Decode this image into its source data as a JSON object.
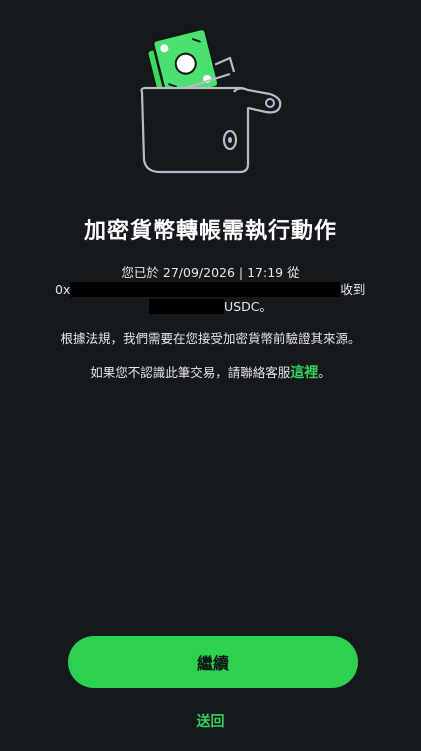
{
  "title": "加密貨幣轉帳需執行動作",
  "details": {
    "line1": "您已於 27/09/2026 | 17:19 從",
    "address_prefix": "0x",
    "received_label": "收到",
    "currency_suffix": "USDC。"
  },
  "paragraph_regulation": "根據法規，我們需要在您接受加密貨幣前驗證其來源。",
  "paragraph_help_prefix": "如果您不認識此筆交易，請聯絡客服",
  "help_link_label": "這裡",
  "paragraph_help_suffix": "。",
  "buttons": {
    "continue_label": "繼續",
    "back_label": "送回"
  },
  "colors": {
    "background": "#15181d",
    "accent": "#2dd150"
  },
  "illustration": {
    "icon": "wallet-with-cash-icon"
  }
}
